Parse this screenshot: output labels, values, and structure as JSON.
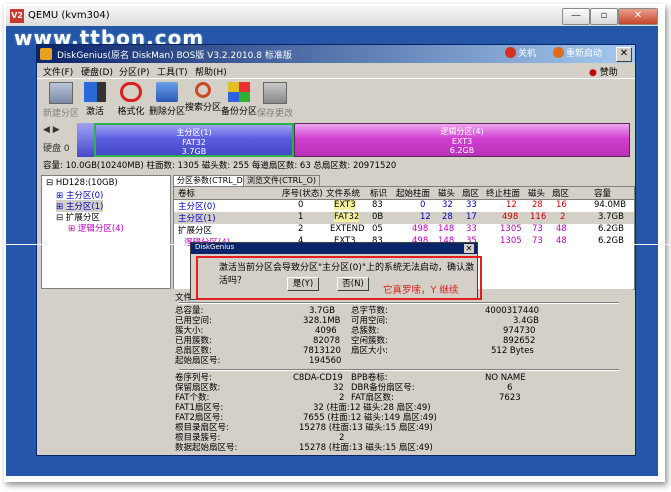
{
  "window": {
    "title": "QEMU (kvm304)",
    "min": "—",
    "max": "▫",
    "close": "✕"
  },
  "watermark": "www.ttbon.com",
  "app": {
    "title": "DiskGenius(原名 DiskMan) BOS版 V3.2.2010.8 标准版",
    "shutdown": "关机",
    "restart": "重新启动",
    "help_right": "赞助"
  },
  "menu": [
    "文件(F)",
    "硬盘(D)",
    "分区(P)",
    "工具(T)",
    "帮助(H)"
  ],
  "toolbar": [
    {
      "label": "新建分区",
      "icon": "new-partition-icon"
    },
    {
      "label": "激活",
      "icon": "activate-icon"
    },
    {
      "label": "格式化",
      "icon": "format-icon"
    },
    {
      "label": "删除分区",
      "icon": "delete-partition-icon"
    },
    {
      "label": "搜索分区",
      "icon": "search-partition-icon"
    },
    {
      "label": "备份分区",
      "icon": "backup-partition-icon"
    },
    {
      "label": "保存更改",
      "icon": "save-changes-icon"
    }
  ],
  "disk": {
    "label": "硬盘 0",
    "primary": {
      "line1": "主分区(1)",
      "line2": "FAT32",
      "line3": "3.7GB"
    },
    "extended": {
      "line1": "逻辑分区(4)",
      "line2": "EXT3",
      "line3": "6.2GB"
    },
    "info": "容量: 10.0GB(10240MB)  柱面数: 1305  磁头数: 255  每道扇区数: 63  总扇区数: 20971520"
  },
  "tree": {
    "root": "HD128:(10GB)",
    "items": [
      "主分区(0)",
      "主分区(1)",
      "扩展分区",
      "逻辑分区(4)"
    ]
  },
  "tabs": [
    "分区参数(CTRL_D)",
    "浏览文件(CTRL_O)"
  ],
  "table": {
    "headers": [
      "卷标",
      "序号(状态)",
      "文件系统",
      "标识",
      "起始柱面",
      "磁头",
      "扇区",
      "终止柱面",
      "磁头",
      "扇区",
      "容量"
    ],
    "rows": [
      [
        "主分区(0)",
        "0",
        "EXT3",
        "83",
        "0",
        "32",
        "33",
        "12",
        "28",
        "16",
        "94.0MB"
      ],
      [
        "主分区(1)",
        "1",
        "FAT32",
        "0B",
        "12",
        "28",
        "17",
        "498",
        "116",
        "2",
        "3.7GB"
      ],
      [
        "扩展分区",
        "2",
        "EXTEND",
        "05",
        "498",
        "148",
        "33",
        "1305",
        "73",
        "48",
        "6.2GB"
      ],
      [
        "逻辑分区(4)",
        "4",
        "EXT3",
        "83",
        "498",
        "148",
        "35",
        "1305",
        "73",
        "48",
        "6.2GB"
      ]
    ]
  },
  "dialog": {
    "title": "DiskGenius",
    "message": "激活当前分区会导致分区\"主分区(0)\"上的系统无法启动，确认激活吗？",
    "yes": "是(Y)",
    "no": "否(N)",
    "annotation": "它真罗嗦，Y 继续"
  },
  "details": {
    "left_label": "文件",
    "block1": [
      [
        "总容量:",
        "3.7GB",
        "总字节数:",
        "4000317440"
      ],
      [
        "已用空间:",
        "328.1MB",
        "可用空间:",
        "3.4GB"
      ],
      [
        "簇大小:",
        "4096",
        "总簇数:",
        "974730"
      ],
      [
        "已用簇数:",
        "82078",
        "空闲簇数:",
        "892652"
      ],
      [
        "总扇区数:",
        "7813120",
        "扇区大小:",
        "512 Bytes"
      ],
      [
        "起始扇区号:",
        "194560",
        "",
        ""
      ]
    ],
    "block2": [
      [
        "卷序列号:",
        "C8DA-CD19",
        "BPB卷标:",
        "NO NAME"
      ],
      [
        "保留扇区数:",
        "32",
        "DBR备份扇区号:",
        "6"
      ],
      [
        "FAT个数:",
        "2",
        "FAT扇区数:",
        "7623"
      ],
      [
        "FAT1扇区号:",
        "32 (柱面:12 磁头:28 扇区:49)",
        "",
        ""
      ],
      [
        "FAT2扇区号:",
        "7655 (柱面:12 磁头:149 扇区:49)",
        "",
        ""
      ],
      [
        "根目录扇区号:",
        "15278 (柱面:13 磁头:15 扇区:49)",
        "",
        ""
      ],
      [
        "根目录簇号:",
        "2",
        "",
        ""
      ],
      [
        "数据起始扇区号:",
        "15278 (柱面:13 磁头:15 扇区:49)",
        "",
        ""
      ]
    ]
  }
}
